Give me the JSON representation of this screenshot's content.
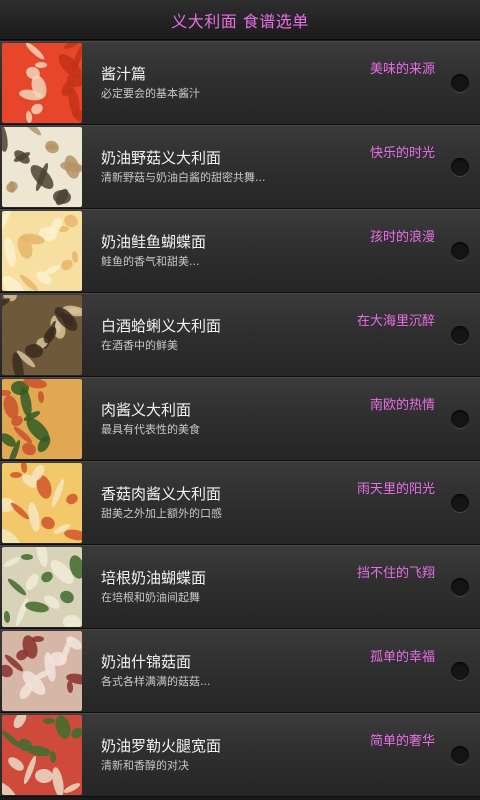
{
  "header": {
    "title": "义大利面 食谱选单"
  },
  "recipes": [
    {
      "name": "酱汁篇",
      "desc": "必定要会的基本酱汁",
      "tag": "美味的来源",
      "image": "tomato-sauce-bowl",
      "colors": [
        "#e8462a",
        "#f0d6b8",
        "#c23318"
      ]
    },
    {
      "name": "奶油野菇义大利面",
      "desc": "清新野菇与奶油白酱的甜密共舞...",
      "tag": "快乐的时光",
      "image": "mushroom-cream-pasta",
      "colors": [
        "#ede6d2",
        "#b39466",
        "#4d4232"
      ]
    },
    {
      "name": "奶油鲑鱼蝴蝶面",
      "desc": "鲑鱼的香气和甜美...",
      "tag": "孩时的浪漫",
      "image": "salmon-farfalle",
      "colors": [
        "#f6dfa0",
        "#e8b56a",
        "#fbf2cf"
      ]
    },
    {
      "name": "白酒蛤蜊义大利面",
      "desc": "在酒香中的鲜美",
      "tag": "在大海里沉醉",
      "image": "clam-pasta",
      "colors": [
        "#6e5a3a",
        "#d9c39a",
        "#3b2c1e"
      ]
    },
    {
      "name": "肉酱义大利面",
      "desc": "最具有代表性的美食",
      "tag": "南欧的热情",
      "image": "bolognese",
      "colors": [
        "#e0a850",
        "#c9502e",
        "#2e5b24"
      ]
    },
    {
      "name": "香菇肉酱义大利面",
      "desc": "甜美之外加上额外的口感",
      "tag": "雨天里的阳光",
      "image": "mushroom-meat-sauce",
      "colors": [
        "#f2c86a",
        "#d2552a",
        "#f6e6c0"
      ]
    },
    {
      "name": "培根奶油蝴蝶面",
      "desc": "在培根和奶油间起舞",
      "tag": "挡不住的飞翔",
      "image": "bacon-cream-farfalle",
      "colors": [
        "#d8d2b8",
        "#3f6b2a",
        "#f0ecd8"
      ]
    },
    {
      "name": "奶油什锦菇面",
      "desc": "各式各样满满的菇菇...",
      "tag": "孤单的幸福",
      "image": "assorted-mushroom-pasta",
      "colors": [
        "#d6b6a6",
        "#8a2f2a",
        "#f1e4dc"
      ]
    },
    {
      "name": "奶油罗勒火腿宽面",
      "desc": "清新和香醇的对决",
      "tag": "简单的奢华",
      "image": "basil-ham-fettuccine",
      "colors": [
        "#cf4a3a",
        "#3c6f2e",
        "#eadcc6"
      ]
    }
  ]
}
